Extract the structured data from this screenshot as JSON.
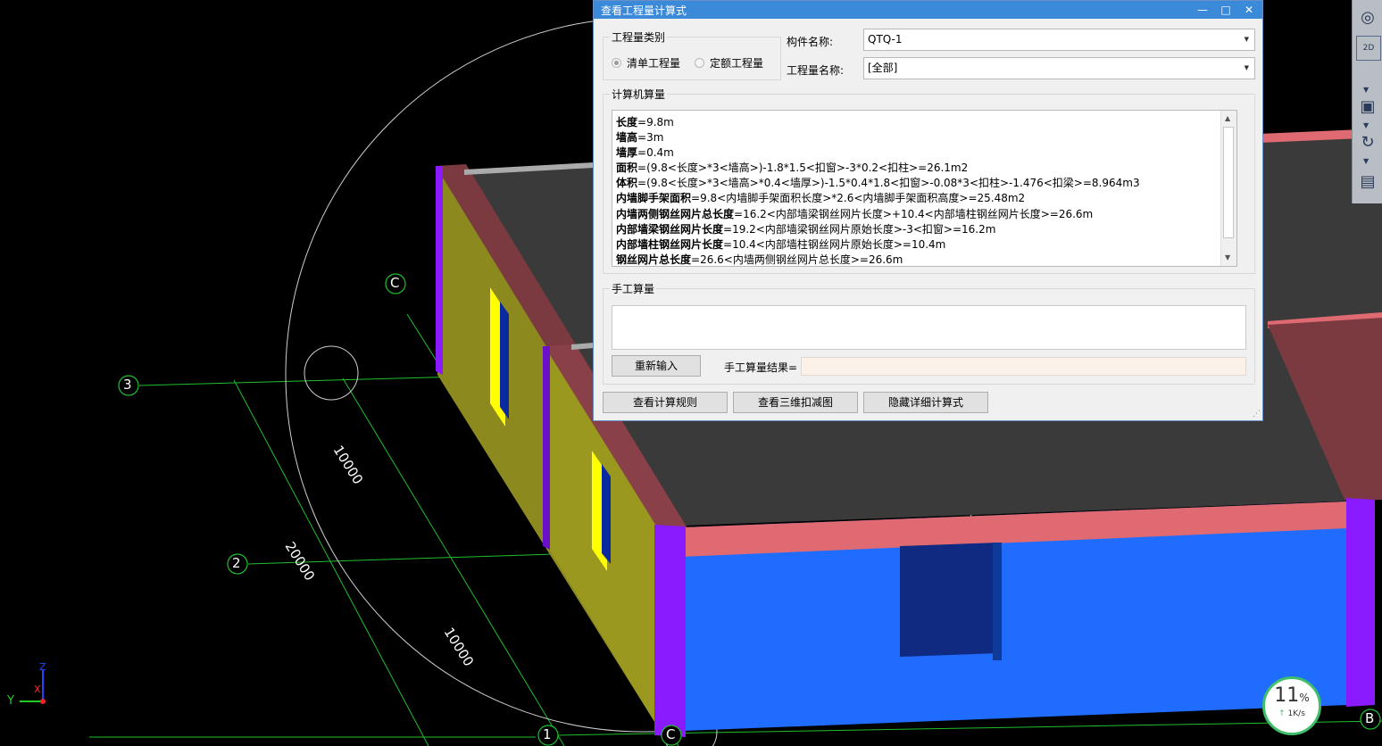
{
  "dialog": {
    "title": "查看工程量计算式",
    "win_min": "—",
    "win_max": "□",
    "win_close": "✕",
    "category_group_title": "工程量类别",
    "radio_qingdan": "清单工程量",
    "radio_dinge": "定额工程量",
    "component_label": "构件名称:",
    "component_value": "QTQ-1",
    "quantity_label": "工程量名称:",
    "quantity_value": "[全部]",
    "calc_group_title": "计算机算量",
    "calc_lines": [
      {
        "name": "长度",
        "expr": "=9.8m"
      },
      {
        "name": "墙高",
        "expr": "=3m"
      },
      {
        "name": "墙厚",
        "expr": "=0.4m"
      },
      {
        "name": "面积",
        "expr": "=(9.8<长度>*3<墙高>)-1.8*1.5<扣窗>-3*0.2<扣柱>=26.1m2"
      },
      {
        "name": "体积",
        "expr": "=(9.8<长度>*3<墙高>*0.4<墙厚>)-1.5*0.4*1.8<扣窗>-0.08*3<扣柱>-1.476<扣梁>=8.964m3"
      },
      {
        "name": "内墙脚手架面积",
        "expr": "=9.8<内墙脚手架面积长度>*2.6<内墙脚手架面积高度>=25.48m2"
      },
      {
        "name": "内墙两侧钢丝网片总长度",
        "expr": "=16.2<内部墙梁钢丝网片长度>+10.4<内部墙柱钢丝网片长度>=26.6m"
      },
      {
        "name": "内部墙梁钢丝网片长度",
        "expr": "=19.2<内部墙梁钢丝网片原始长度>-3<扣窗>=16.2m"
      },
      {
        "name": "内部墙柱钢丝网片长度",
        "expr": "=10.4<内部墙柱钢丝网片原始长度>=10.4m"
      },
      {
        "name": "钢丝网片总长度",
        "expr": "=26.6<内墙两侧钢丝网片总长度>=26.6m"
      }
    ],
    "manual_group_title": "手工算量",
    "reinput_button": "重新输入",
    "manual_result_label": "手工算量结果=",
    "view_rules_button": "查看计算规则",
    "view_3d_button": "查看三维扣减图",
    "hide_detail_button": "隐藏详细计算式"
  },
  "scene": {
    "axis_labels": [
      "C",
      "3",
      "2",
      "1",
      "C",
      "B"
    ],
    "dimensions": [
      "10000",
      "20000",
      "10000"
    ],
    "axis_z": "Z",
    "axis_x": "X",
    "axis_y": "Y"
  },
  "toolbar": {
    "btn_2d": "2D"
  },
  "network": {
    "percent": "11",
    "percent_unit": "%",
    "speed": "1K/s"
  },
  "colors": {
    "title_bar": "#3b8ad9",
    "wall_blue": "#1f6cff",
    "wall_olive": "#8c8a1f",
    "beam_red": "#e06a72",
    "column_purple": "#8a1aff"
  }
}
